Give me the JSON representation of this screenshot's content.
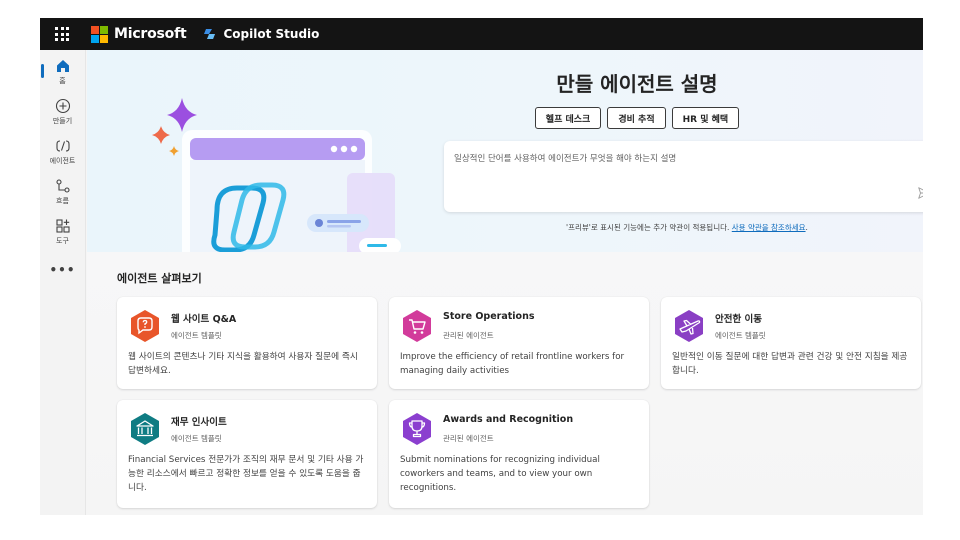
{
  "topbar": {
    "brand": "Microsoft",
    "product": "Copilot Studio",
    "ms_colors": [
      "#f25022",
      "#7fba00",
      "#00a4ef",
      "#ffb900"
    ]
  },
  "sidebar": {
    "items": [
      {
        "label": "홈",
        "icon": "home-icon"
      },
      {
        "label": "만들기",
        "icon": "plus-circle-icon"
      },
      {
        "label": "에이전트",
        "icon": "agent-icon"
      },
      {
        "label": "흐름",
        "icon": "flow-icon"
      },
      {
        "label": "도구",
        "icon": "tools-icon"
      }
    ],
    "more": "•••"
  },
  "hero": {
    "title": "만들 에이전트 설명",
    "chips": [
      "헬프 데스크",
      "경비 추적",
      "HR 및 혜택"
    ],
    "placeholder": "일상적인 단어를 사용하여 에이전트가 무엇을 해야 하는지 설명",
    "terms_text": "'프리뷰'로 표시된 기능에는 추가 약관이 적용됩니다. ",
    "terms_link": "사용 약관을 참조하세요",
    "terms_end": "."
  },
  "explore": {
    "title": "에이전트 살펴보기",
    "cards": [
      {
        "title": "웹 사이트 Q&A",
        "subtitle": "에이전트 템플릿",
        "desc": "웹 사이트의 콘텐츠나 기타 지식을 활용하여 사용자 질문에 즉시 답변하세요.",
        "icon": "chat-question-icon",
        "color": "#e8552a"
      },
      {
        "title": "Store Operations",
        "subtitle": "관리된 에이전트",
        "desc": "Improve the efficiency of retail frontline workers for managing daily activities",
        "icon": "cart-icon",
        "color": "#d23b9b"
      },
      {
        "title": "안전한 이동",
        "subtitle": "에이전트 템플릿",
        "desc": "일반적인 이동 질문에 대한 답변과 관련 건강 및 안전 지침을 제공합니다.",
        "icon": "airplane-icon",
        "color": "#8a3fc4"
      },
      {
        "title": "재무 인사이트",
        "subtitle": "에이전트 템플릿",
        "desc": "Financial Services 전문가가 조직의 재무 문서 및 기타 사용 가능한 리소스에서 빠르고 정확한 정보를 얻을 수 있도록 도움을 줍니다.",
        "icon": "bank-icon",
        "color": "#0f7c83"
      },
      {
        "title": "Awards and Recognition",
        "subtitle": "관리된 에이전트",
        "desc": "Submit nominations for recognizing individual coworkers and teams, and to view your own recognitions.",
        "icon": "trophy-icon",
        "color": "#8b3fcf"
      }
    ]
  }
}
